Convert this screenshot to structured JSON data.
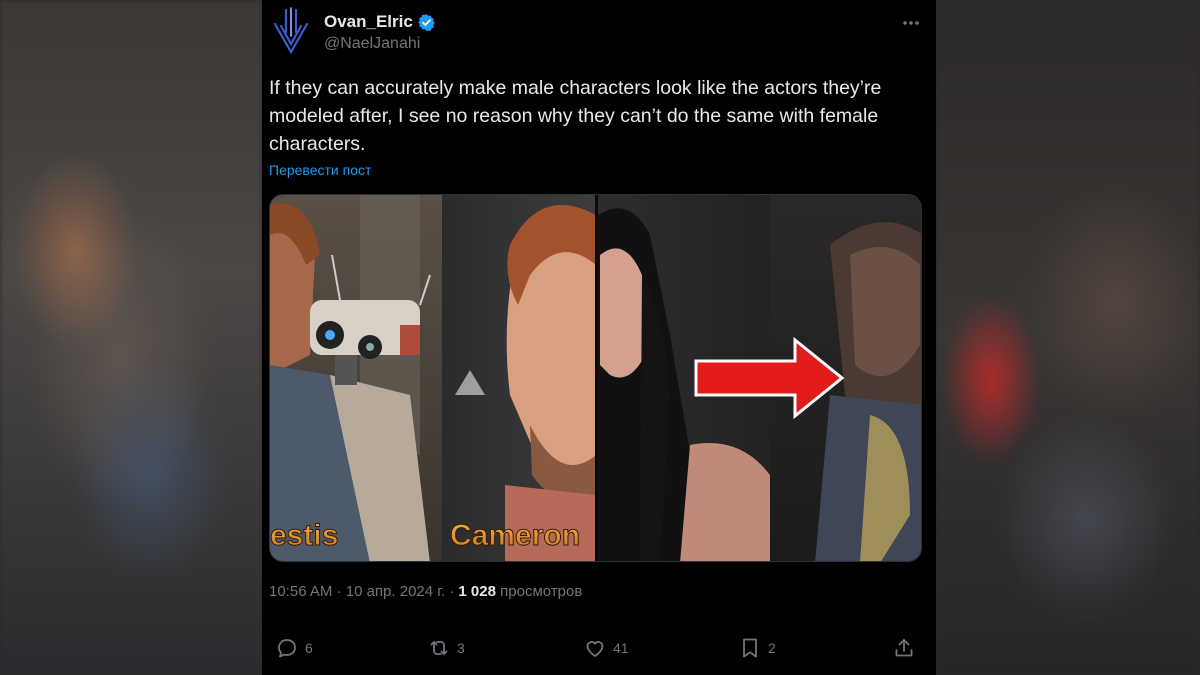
{
  "tweet": {
    "author_name": "Ovan_Elric",
    "author_handle": "@NaelJanahi",
    "text": "If they can accurately make male characters look like the actors they’re modeled after, I see no reason why they can’t do the same with female characters.",
    "translate_link": "Перевести пост",
    "time": "10:56 AM",
    "separator": "·",
    "date": "10 апр. 2024 г.",
    "views_count": "1 028",
    "views_label": "просмотров"
  },
  "media": {
    "caption_left": "estis",
    "caption_mid": "Cameron",
    "arrow_color": "#e21b1b"
  },
  "actions": {
    "replies": "6",
    "reposts": "3",
    "likes": "41",
    "bookmarks": "2"
  },
  "colors": {
    "background": "#000000",
    "text": "#e7e9ea",
    "muted": "#71767b",
    "link": "#1d9bf0",
    "verified": "#1d9bf0"
  }
}
